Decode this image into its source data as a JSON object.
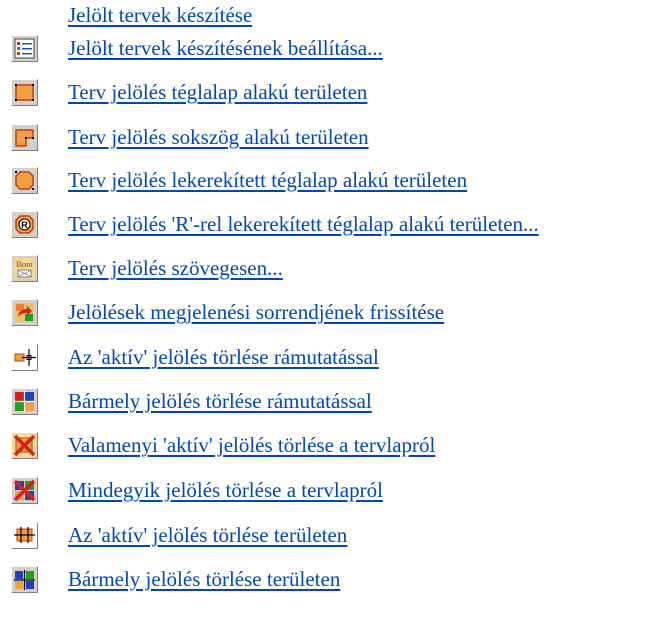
{
  "menu": {
    "items": [
      {
        "label": "Jelölt tervek készítése",
        "icon": null
      },
      {
        "label": "Jelölt tervek készítésének beállítása...",
        "icon": "settings-list-icon"
      },
      {
        "label": "Terv jelölés téglalap alakú területen",
        "icon": "rectangle-mark-icon"
      },
      {
        "label": "Terv jelölés sokszög alakú területen",
        "icon": "polygon-mark-icon"
      },
      {
        "label": "Terv jelölés lekerekített téglalap alakú területen",
        "icon": "rounded-rectangle-mark-icon"
      },
      {
        "label": "Terv jelölés 'R'-rel lekerekített téglalap alakú területen...",
        "icon": "r-rounded-rectangle-mark-icon"
      },
      {
        "label": "Terv jelölés szövegesen...",
        "icon": "text-mark-icon",
        "icon_text": "Bont"
      },
      {
        "label": "Jelölések megjelenési sorrendjének frissítése",
        "icon": "refresh-order-icon"
      },
      {
        "label": "Az 'aktív' jelölés törlése rámutatással",
        "icon": "delete-active-pointer-icon"
      },
      {
        "label": "Bármely jelölés törlése rámutatással",
        "icon": "delete-any-pointer-icon"
      },
      {
        "label": "Valamenyi 'aktív' jelölés törlése a tervlapról",
        "icon": "delete-all-active-icon"
      },
      {
        "label": "Mindegyik jelölés törlése a tervlapról",
        "icon": "delete-all-icon"
      },
      {
        "label": "Az 'aktív' jelölés törlése területen",
        "icon": "delete-active-area-icon"
      },
      {
        "label": "Bármely jelölés törlése területen",
        "icon": "delete-any-area-icon"
      }
    ]
  },
  "colors": {
    "link": "#0047b8",
    "icon_face": "#d4d0c8",
    "mark_orange": "#f0a040",
    "mark_red": "#d62020"
  }
}
